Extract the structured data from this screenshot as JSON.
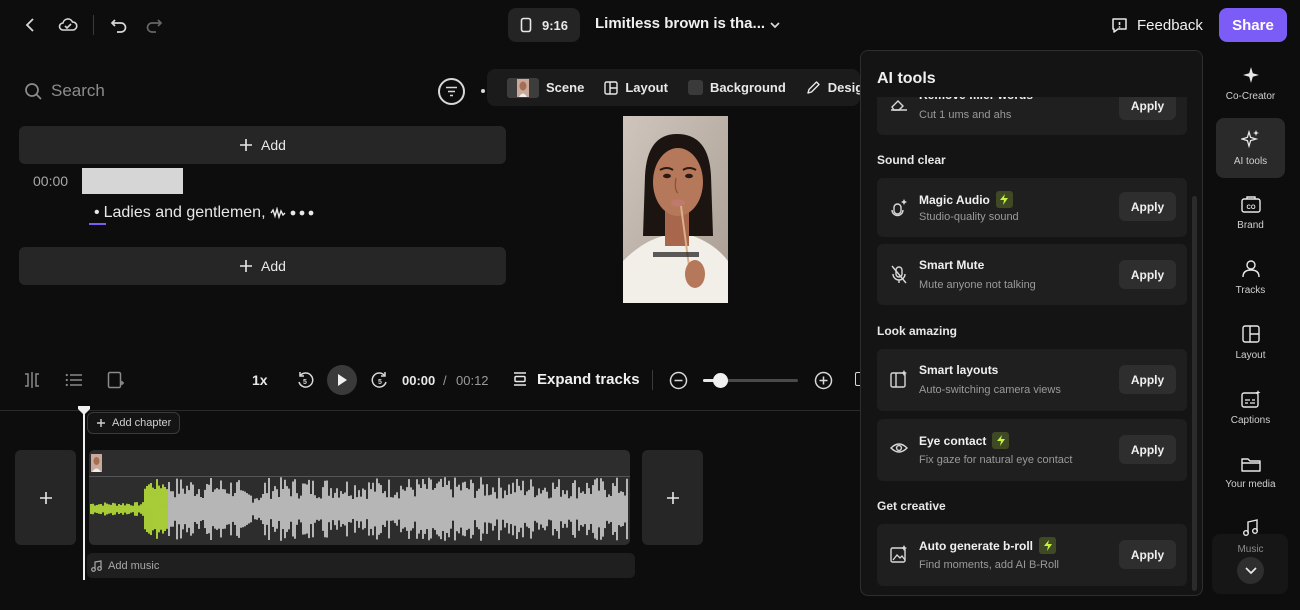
{
  "topbar": {
    "aspect_ratio": "9:16",
    "project_title": "Limitless brown is tha...",
    "feedback_label": "Feedback",
    "share_label": "Share"
  },
  "script_panel": {
    "search_placeholder": "Search",
    "add_label_top": "Add",
    "add_label_bottom": "Add",
    "segment_time": "00:00",
    "segment_text": "Ladies and gentlemen,"
  },
  "scene_toolbar": {
    "scene_label": "Scene",
    "layout_label": "Layout",
    "background_label": "Background",
    "design_label": "Design"
  },
  "playback": {
    "speed": "1x",
    "current_time": "00:00",
    "separator": "/",
    "total_time": "00:12",
    "expand_label": "Expand tracks",
    "zoom_level": 0.18
  },
  "timeline": {
    "add_chapter_label": "Add chapter",
    "add_music_label": "Add music"
  },
  "ai_tools": {
    "title": "AI tools",
    "partial_tool": {
      "name": "Remove filler words",
      "desc": "Cut 1 ums and ahs",
      "apply": "Apply"
    },
    "sections": {
      "sound_clear": "Sound clear",
      "look_amazing": "Look amazing",
      "get_creative": "Get creative"
    },
    "tools": {
      "magic_audio": {
        "name": "Magic Audio",
        "desc": "Studio-quality sound",
        "apply": "Apply"
      },
      "smart_mute": {
        "name": "Smart Mute",
        "desc": "Mute anyone not talking",
        "apply": "Apply"
      },
      "smart_layouts": {
        "name": "Smart layouts",
        "desc": "Auto-switching camera views",
        "apply": "Apply"
      },
      "eye_contact": {
        "name": "Eye contact",
        "desc": "Fix gaze for natural eye contact",
        "apply": "Apply"
      },
      "auto_broll": {
        "name": "Auto generate b-roll",
        "desc": "Find moments, add AI B-Roll",
        "apply": "Apply"
      }
    }
  },
  "sidebar": {
    "items": [
      {
        "label": "Co-Creator",
        "icon": "sparkle-icon"
      },
      {
        "label": "AI tools",
        "icon": "ai-tools-icon"
      },
      {
        "label": "Brand",
        "icon": "brand-icon"
      },
      {
        "label": "Tracks",
        "icon": "tracks-icon"
      },
      {
        "label": "Layout",
        "icon": "layout-icon"
      },
      {
        "label": "Captions",
        "icon": "captions-icon"
      },
      {
        "label": "Your media",
        "icon": "folder-icon"
      },
      {
        "label": "Music",
        "icon": "music-icon"
      }
    ]
  },
  "colors": {
    "accent": "#7c5cf6",
    "waveform_highlight": "#c6f33b",
    "waveform": "#d9d9d9",
    "background": "#0d0d0d"
  }
}
